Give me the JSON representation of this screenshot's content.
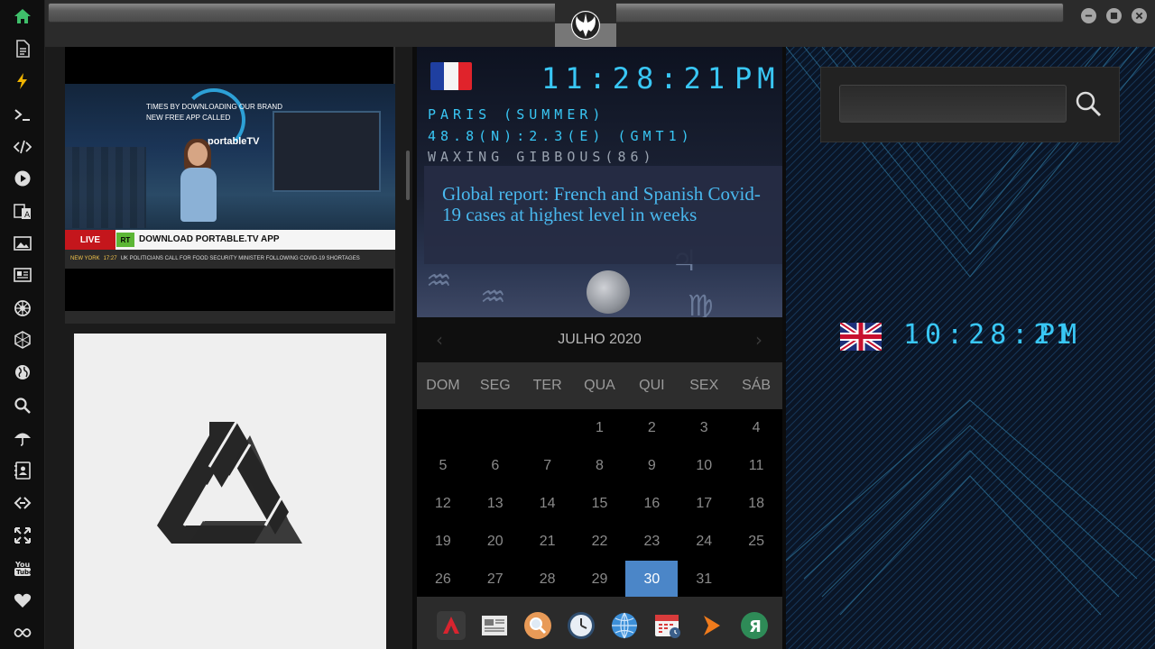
{
  "sidebar": {
    "items": [
      {
        "icon": "home-icon",
        "color": "#3fbf6a"
      },
      {
        "icon": "document-icon"
      },
      {
        "icon": "lightning-icon",
        "color": "#f0b400"
      },
      {
        "icon": "terminal-icon"
      },
      {
        "icon": "code-icon"
      },
      {
        "icon": "play-icon"
      },
      {
        "icon": "translate-icon"
      },
      {
        "icon": "image-icon"
      },
      {
        "icon": "newspaper-icon"
      },
      {
        "icon": "empire-icon"
      },
      {
        "icon": "hexagon-icon"
      },
      {
        "icon": "globe-icon"
      },
      {
        "icon": "search-icon"
      },
      {
        "icon": "umbrella-icon"
      },
      {
        "icon": "contact-icon"
      },
      {
        "icon": "link-icon"
      },
      {
        "icon": "fullscreen-icon"
      },
      {
        "icon": "youtube-icon"
      },
      {
        "icon": "heart-icon"
      },
      {
        "icon": "infinity-icon"
      }
    ]
  },
  "titlebar": {
    "address_value": "",
    "logo_icon": "rebel-alliance-icon",
    "buttons": [
      "minimize-icon",
      "maximize-icon",
      "close-icon"
    ]
  },
  "video": {
    "caption_line1": "TIMES BY DOWNLOADING OUR BRAND",
    "caption_line2": "NEW FREE APP CALLED",
    "brand": "portableTV",
    "live_label": "LIVE",
    "channel": "RT",
    "headline": "DOWNLOAD PORTABLE.TV APP",
    "ticker_city": "NEW YORK",
    "ticker_time": "17:27",
    "ticker_text": "UK POLITICIANS CALL FOR FOOD SECURITY MINISTER FOLLOWING COVID-19 SHORTAGES"
  },
  "paris_clock": {
    "time": "11:28:21",
    "ampm": "PM",
    "city": "PARIS (SUMMER)",
    "coords": "48.8(N):2.3(E) (GMT1)",
    "moon": "WAXING GIBBOUS(86)",
    "flag_colors": [
      "#1f3fa0",
      "#f5f5f5",
      "#e0232b"
    ]
  },
  "news": {
    "headline": "Global report: French and Spanish Covid-19 cases at highest level in weeks"
  },
  "calendar": {
    "title": "JULHO 2020",
    "prev": "‹",
    "next": "›",
    "weekdays": [
      "DOM",
      "SEG",
      "TER",
      "QUA",
      "QUI",
      "SEX",
      "SÁB"
    ],
    "weeks": [
      [
        "",
        "",
        "",
        "1",
        "2",
        "3",
        "4"
      ],
      [
        "5",
        "6",
        "7",
        "8",
        "9",
        "10",
        "11"
      ],
      [
        "12",
        "13",
        "14",
        "15",
        "16",
        "17",
        "18"
      ],
      [
        "19",
        "20",
        "21",
        "22",
        "23",
        "24",
        "25"
      ],
      [
        "26",
        "27",
        "28",
        "29",
        "30",
        "31",
        ""
      ]
    ],
    "today": "30",
    "accent": "#4b86c8"
  },
  "dock": {
    "items": [
      "arch-app-icon",
      "newspaper-app-icon",
      "search-app-icon",
      "clock-app-icon",
      "globe-app-icon",
      "calendar-app-icon",
      "arrow-app-icon",
      "yandex-app-icon"
    ]
  },
  "search": {
    "value": "",
    "button_icon": "search-icon"
  },
  "uk_clock": {
    "time": "10:28:21",
    "ampm": "PM"
  }
}
